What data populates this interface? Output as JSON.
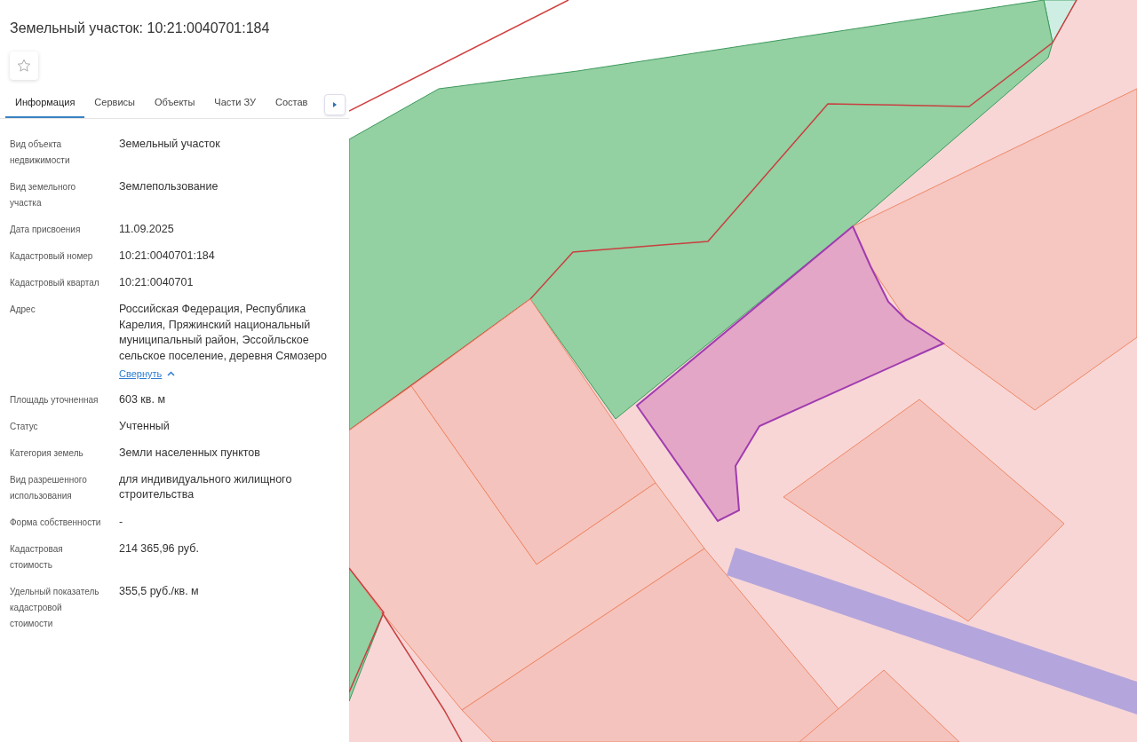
{
  "title": "Земельный участок: 10:21:0040701:184",
  "favorite": false,
  "tabs": [
    {
      "label": "Информация",
      "selected": true
    },
    {
      "label": "Сервисы",
      "selected": false
    },
    {
      "label": "Объекты",
      "selected": false
    },
    {
      "label": "Части ЗУ",
      "selected": false
    },
    {
      "label": "Состав",
      "selected": false
    }
  ],
  "fields": [
    {
      "label": "Вид объекта недвижимости",
      "value": "Земельный участок"
    },
    {
      "label": "Вид земельного участка",
      "value": "Землепользование"
    },
    {
      "label": "Дата присвоения",
      "value": "11.09.2025"
    },
    {
      "label": "Кадастровый номер",
      "value": "10:21:0040701:184"
    },
    {
      "label": "Кадастровый квартал",
      "value": "10:21:0040701"
    },
    {
      "label": "Адрес",
      "value": "Российская Федерация, Республика Карелия, Пряжинский национальный муниципальный район, Эссойльское сельское поселение, деревня Сямозеро",
      "toggle": "Свернуть",
      "expanded": true
    },
    {
      "label": "Площадь уточненная",
      "value": "603 кв. м"
    },
    {
      "label": "Статус",
      "value": "Учтенный"
    },
    {
      "label": "Категория земель",
      "value": "Земли населенных пунктов"
    },
    {
      "label": "Вид разрешенного использования",
      "value": "для индивидуального жилищного строительства"
    },
    {
      "label": "Форма собственности",
      "value": "-"
    },
    {
      "label": "Кадастровая стоимость",
      "value": "214 365,96 руб."
    },
    {
      "label": "Удельный показатель кадастровой стоимости",
      "value": "355,5 руб./кв. м"
    }
  ]
}
